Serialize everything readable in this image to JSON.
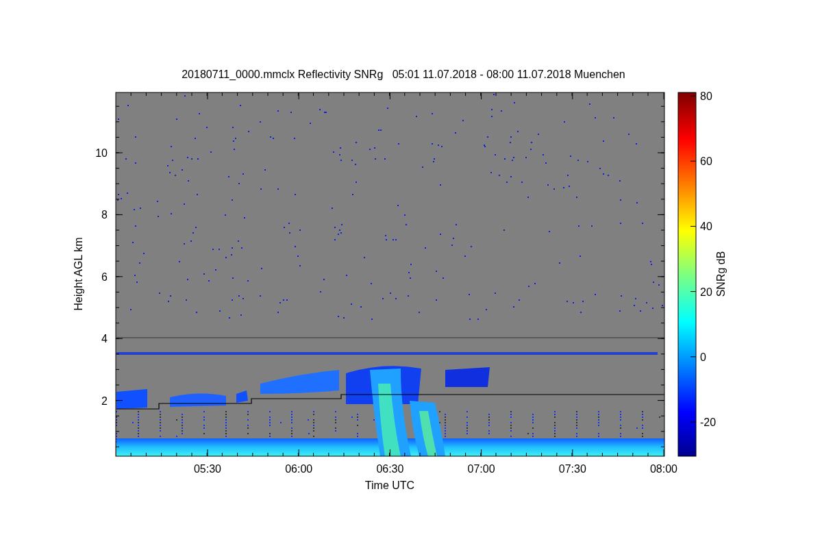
{
  "title": "20180711_0000.mmclx Reflectivity SNRg   05:01 11.07.2018 - 08:00 11.07.2018 Muenchen",
  "y_axis": {
    "label": "Height AGL km",
    "ticks": [
      "10",
      "8",
      "6",
      "4",
      "2"
    ]
  },
  "x_axis": {
    "label": "Time UTC",
    "ticks": [
      "05:30",
      "06:00",
      "06:30",
      "07:00",
      "07:30",
      "08:00"
    ]
  },
  "colorbar": {
    "label": "SNRg dB",
    "ticks": [
      "80",
      "60",
      "40",
      "20",
      "0",
      "-20"
    ]
  }
}
